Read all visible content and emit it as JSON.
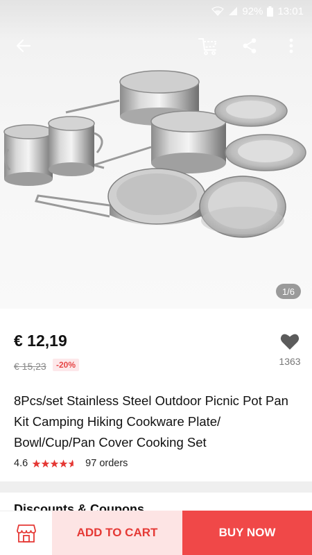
{
  "status_bar": {
    "battery": "92%",
    "time": "13:01",
    "icons": [
      "wifi-icon",
      "signal-icon",
      "battery-icon"
    ]
  },
  "top_bar": {
    "icons": [
      "back-arrow-icon",
      "cart-icon",
      "share-icon",
      "more-vert-icon"
    ]
  },
  "gallery": {
    "indicator": "1/6"
  },
  "product": {
    "price": "€ 12,19",
    "old_price": "€ 15,23",
    "discount": "-20%",
    "favorites": "1363",
    "title": "8Pcs/set Stainless Steel Outdoor Picnic Pot Pan Kit Camping Hiking Cookware Plate/ Bowl/Cup/Pan Cover Cooking Set",
    "rating": "4.6",
    "stars": 4.6,
    "orders": "97 orders"
  },
  "next_section": {
    "title": "Discounts & Coupons"
  },
  "bottom_bar": {
    "add_to_cart": "ADD TO CART",
    "buy_now": "BUY NOW",
    "store_icon": "store-icon"
  },
  "colors": {
    "accent": "#f04848",
    "accent_light": "#fde4e4",
    "discount_text": "#e64545",
    "discount_bg": "#fde8ea"
  }
}
